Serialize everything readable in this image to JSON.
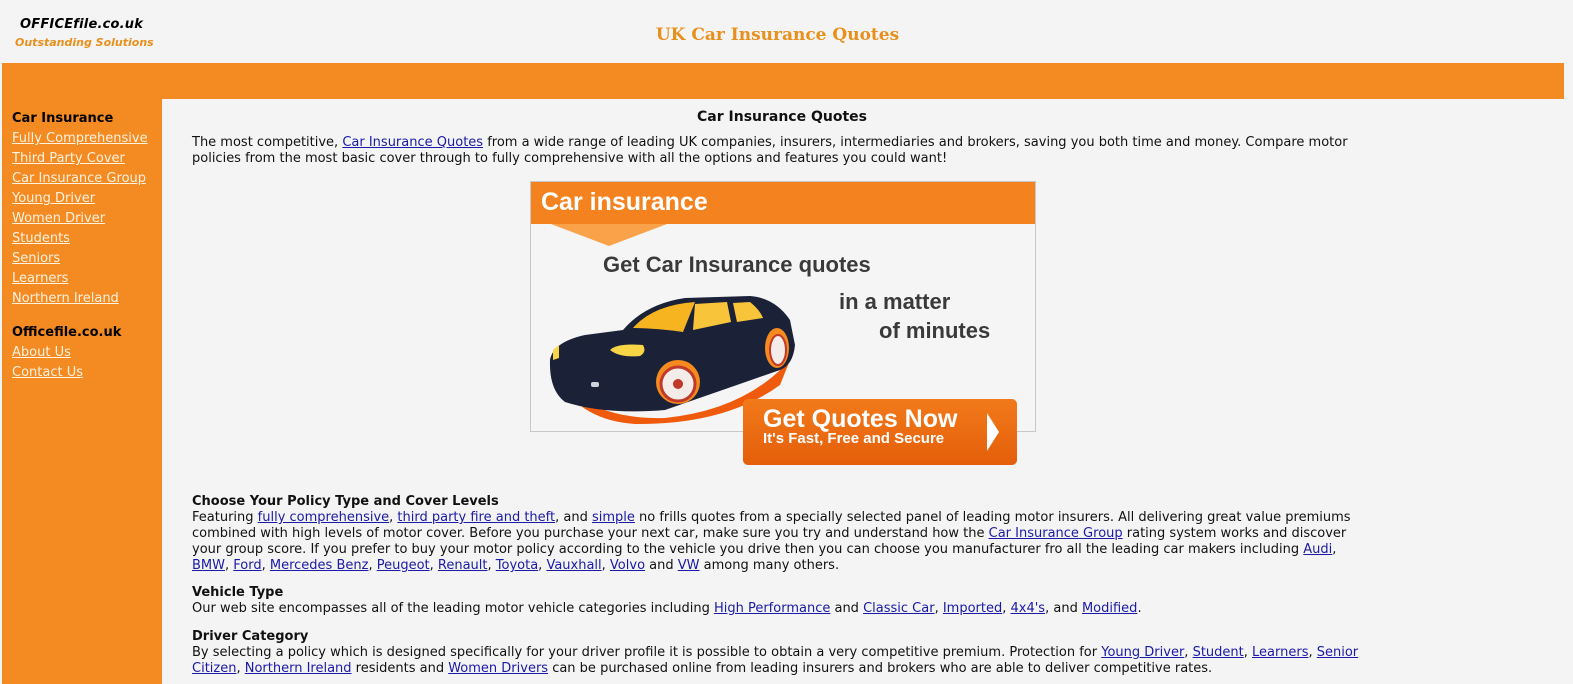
{
  "header": {
    "logo_name": "OFFICEfile.co.uk",
    "logo_tagline": "Outstanding Solutions",
    "site_title": "UK Car Insurance Quotes"
  },
  "colors": {
    "brand_orange": "#f48a22",
    "title_orange": "#e8901c",
    "link_blue": "#1a1aa6"
  },
  "sidebar": {
    "group1_title": "Car Insurance",
    "group1_items": [
      {
        "label": "Fully Comprehensive"
      },
      {
        "label": "Third Party Cover"
      },
      {
        "label": "Car Insurance Group"
      },
      {
        "label": "Young Driver"
      },
      {
        "label": "Women Driver"
      },
      {
        "label": "Students"
      },
      {
        "label": "Seniors"
      },
      {
        "label": "Learners"
      },
      {
        "label": "Northern Ireland"
      }
    ],
    "group2_title": "Officefile.co.uk",
    "group2_items": [
      {
        "label": "About Us"
      },
      {
        "label": "Contact Us"
      }
    ]
  },
  "main": {
    "title": "Car Insurance Quotes",
    "intro": {
      "t1": "The most competitive, ",
      "link": "Car Insurance Quotes",
      "t2": " from a wide range of leading UK companies, insurers, intermediaries and brokers, saving you both time and money. Compare motor policies from the most basic cover through to fully comprehensive with all the options and features you could want!"
    },
    "banner": {
      "heading": "Car insurance",
      "line1": "Get Car Insurance quotes",
      "line2": "in a matter",
      "line3": "of minutes",
      "cta_main": "Get Quotes Now",
      "cta_sub": "It's Fast, Free and Secure"
    },
    "policy": {
      "heading": "Choose Your Policy Type and Cover Levels",
      "t1": "Featuring ",
      "l1": "fully comprehensive",
      "t2": ", ",
      "l2": "third party fire and theft",
      "t3": ", and ",
      "l3": "simple",
      "t4": " no frills quotes from a specially selected panel of leading motor insurers. All delivering great value premiums combined with high levels of motor cover. Before you purchase your next car, make sure you try and understand how the ",
      "l4": "Car Insurance Group",
      "t5": " rating system works and discover your group score. If you prefer to buy your motor policy according to the vehicle you drive then you can choose you manufacturer fro all the leading car makers including ",
      "makers": [
        "Audi",
        "BMW",
        "Ford",
        "Mercedes Benz",
        "Peugeot",
        "Renault",
        "Toyota",
        "Vauxhall",
        "Volvo",
        "VW"
      ],
      "and": " and ",
      "sep": ", ",
      "t6": " among many others."
    },
    "vehicle": {
      "heading": "Vehicle Type",
      "t1": "Our web site encompasses all of the leading motor vehicle categories including ",
      "l1": "High Performance",
      "t2": " and ",
      "l2": "Classic Car",
      "sep": ", ",
      "l3": "Imported",
      "l4": "4x4's",
      "t3": ", and ",
      "l5": "Modified",
      "t4": "."
    },
    "driver": {
      "heading": "Driver Category",
      "t1": "By selecting a policy which is designed specifically for your driver profile it is possible to obtain a very competitive premium. Protection for ",
      "l1": "Young Driver",
      "sep": ", ",
      "l2": "Student",
      "l3": "Learners",
      "l4": "Senior Citizen",
      "sep2": ", ",
      "l5": "Northern Ireland",
      "t2": " residents and ",
      "l6": "Women Drivers",
      "t3": " can be purchased online from leading insurers and brokers who are able to deliver competitive rates."
    }
  }
}
